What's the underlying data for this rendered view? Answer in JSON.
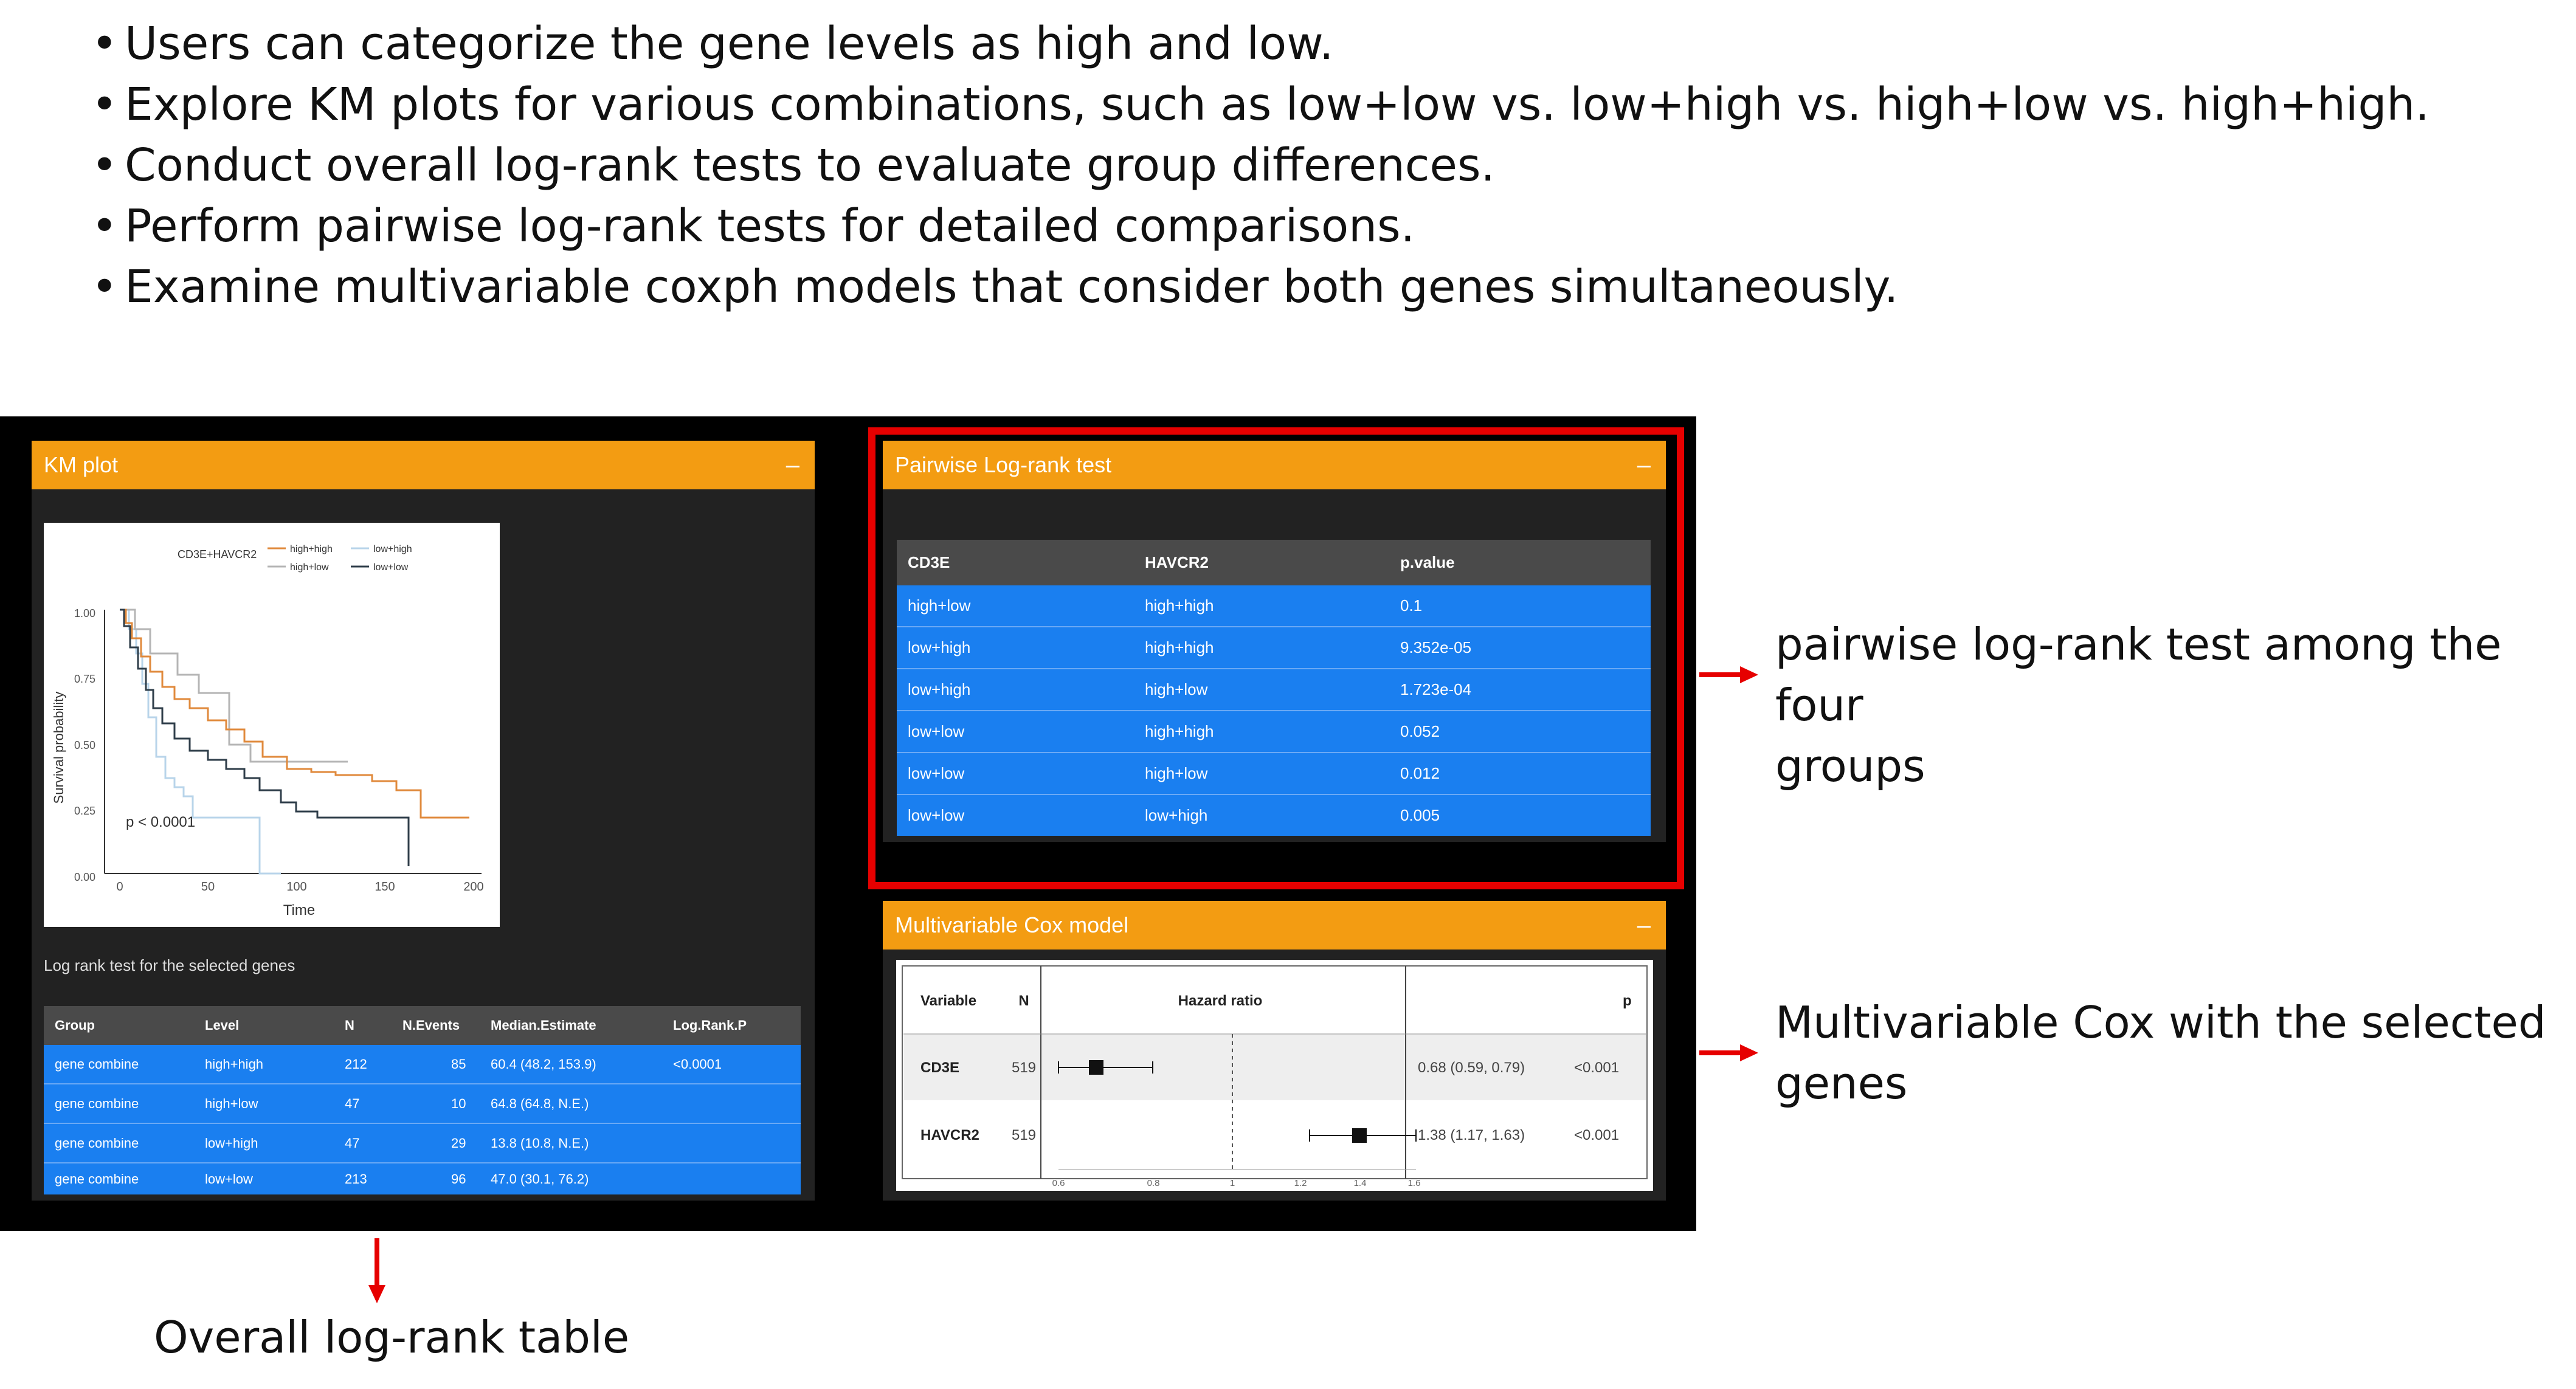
{
  "bullets": [
    "Users can categorize the gene levels as high and low.",
    "Explore KM plots for various combinations, such as low+low vs. low+high vs. high+low vs. high+high.",
    "Conduct overall log-rank tests to evaluate group differences.",
    "Perform pairwise log-rank tests for detailed comparisons.",
    "Examine multivariable coxph models that consider both genes simultaneously."
  ],
  "km_panel": {
    "title": "KM plot",
    "collapse": "–",
    "plot": {
      "legend_title": "CD3E+HAVCR2",
      "legend": [
        "high+high",
        "low+high",
        "high+low",
        "low+low"
      ],
      "y_label": "Survival probability",
      "x_label": "Time",
      "y_ticks": [
        "1.00",
        "0.75",
        "0.50",
        "0.25",
        "0.00"
      ],
      "x_ticks": [
        "0",
        "50",
        "100",
        "150",
        "200"
      ],
      "pvalue": "p < 0.0001",
      "colors": {
        "high_high": "#e08a3c",
        "high_low": "#b5b5b5",
        "low_high": "#b8d4ea",
        "low_low": "#2f3e4a"
      }
    },
    "table_caption": "Log rank test for the selected genes",
    "table": {
      "headers": [
        "Group",
        "Level",
        "N",
        "N.Events",
        "Median.Estimate",
        "Log.Rank.P"
      ],
      "rows": [
        [
          "gene combine",
          "high+high",
          "212",
          "85",
          "60.4 (48.2, 153.9)",
          "<0.0001"
        ],
        [
          "gene combine",
          "high+low",
          "47",
          "10",
          "64.8 (64.8, N.E.)",
          ""
        ],
        [
          "gene combine",
          "low+high",
          "47",
          "29",
          "13.8 (10.8, N.E.)",
          ""
        ],
        [
          "gene combine",
          "low+low",
          "213",
          "96",
          "47.0 (30.1, 76.2)",
          ""
        ]
      ]
    }
  },
  "pairwise_panel": {
    "title": "Pairwise Log-rank test",
    "collapse": "–",
    "headers": [
      "CD3E",
      "HAVCR2",
      "p.value"
    ],
    "rows": [
      [
        "high+low",
        "high+high",
        "0.1"
      ],
      [
        "low+high",
        "high+high",
        "9.352e-05"
      ],
      [
        "low+high",
        "high+low",
        "1.723e-04"
      ],
      [
        "low+low",
        "high+high",
        "0.052"
      ],
      [
        "low+low",
        "high+low",
        "0.012"
      ],
      [
        "low+low",
        "low+high",
        "0.005"
      ]
    ]
  },
  "cox_panel": {
    "title": "Multivariable Cox model",
    "collapse": "–",
    "headers": {
      "variable": "Variable",
      "n": "N",
      "hr": "Hazard ratio",
      "p": "p"
    },
    "rows": [
      {
        "variable": "CD3E",
        "n": "519",
        "hr_text": "0.68 (0.59, 0.79)",
        "p": "<0.001",
        "hr": 0.68,
        "lo": 0.59,
        "hi": 0.79
      },
      {
        "variable": "HAVCR2",
        "n": "519",
        "hr_text": "1.38 (1.17, 1.63)",
        "p": "<0.001",
        "hr": 1.38,
        "lo": 1.17,
        "hi": 1.63
      }
    ],
    "axis_ticks": [
      "0.6",
      "0.8",
      "1",
      "1.2",
      "1.4",
      "1.6"
    ]
  },
  "annotations": {
    "pairwise": [
      "pairwise log-rank test among the four",
      "groups"
    ],
    "cox": [
      "Multivariable Cox with the selected",
      "genes"
    ],
    "overall": "Overall log-rank table"
  }
}
